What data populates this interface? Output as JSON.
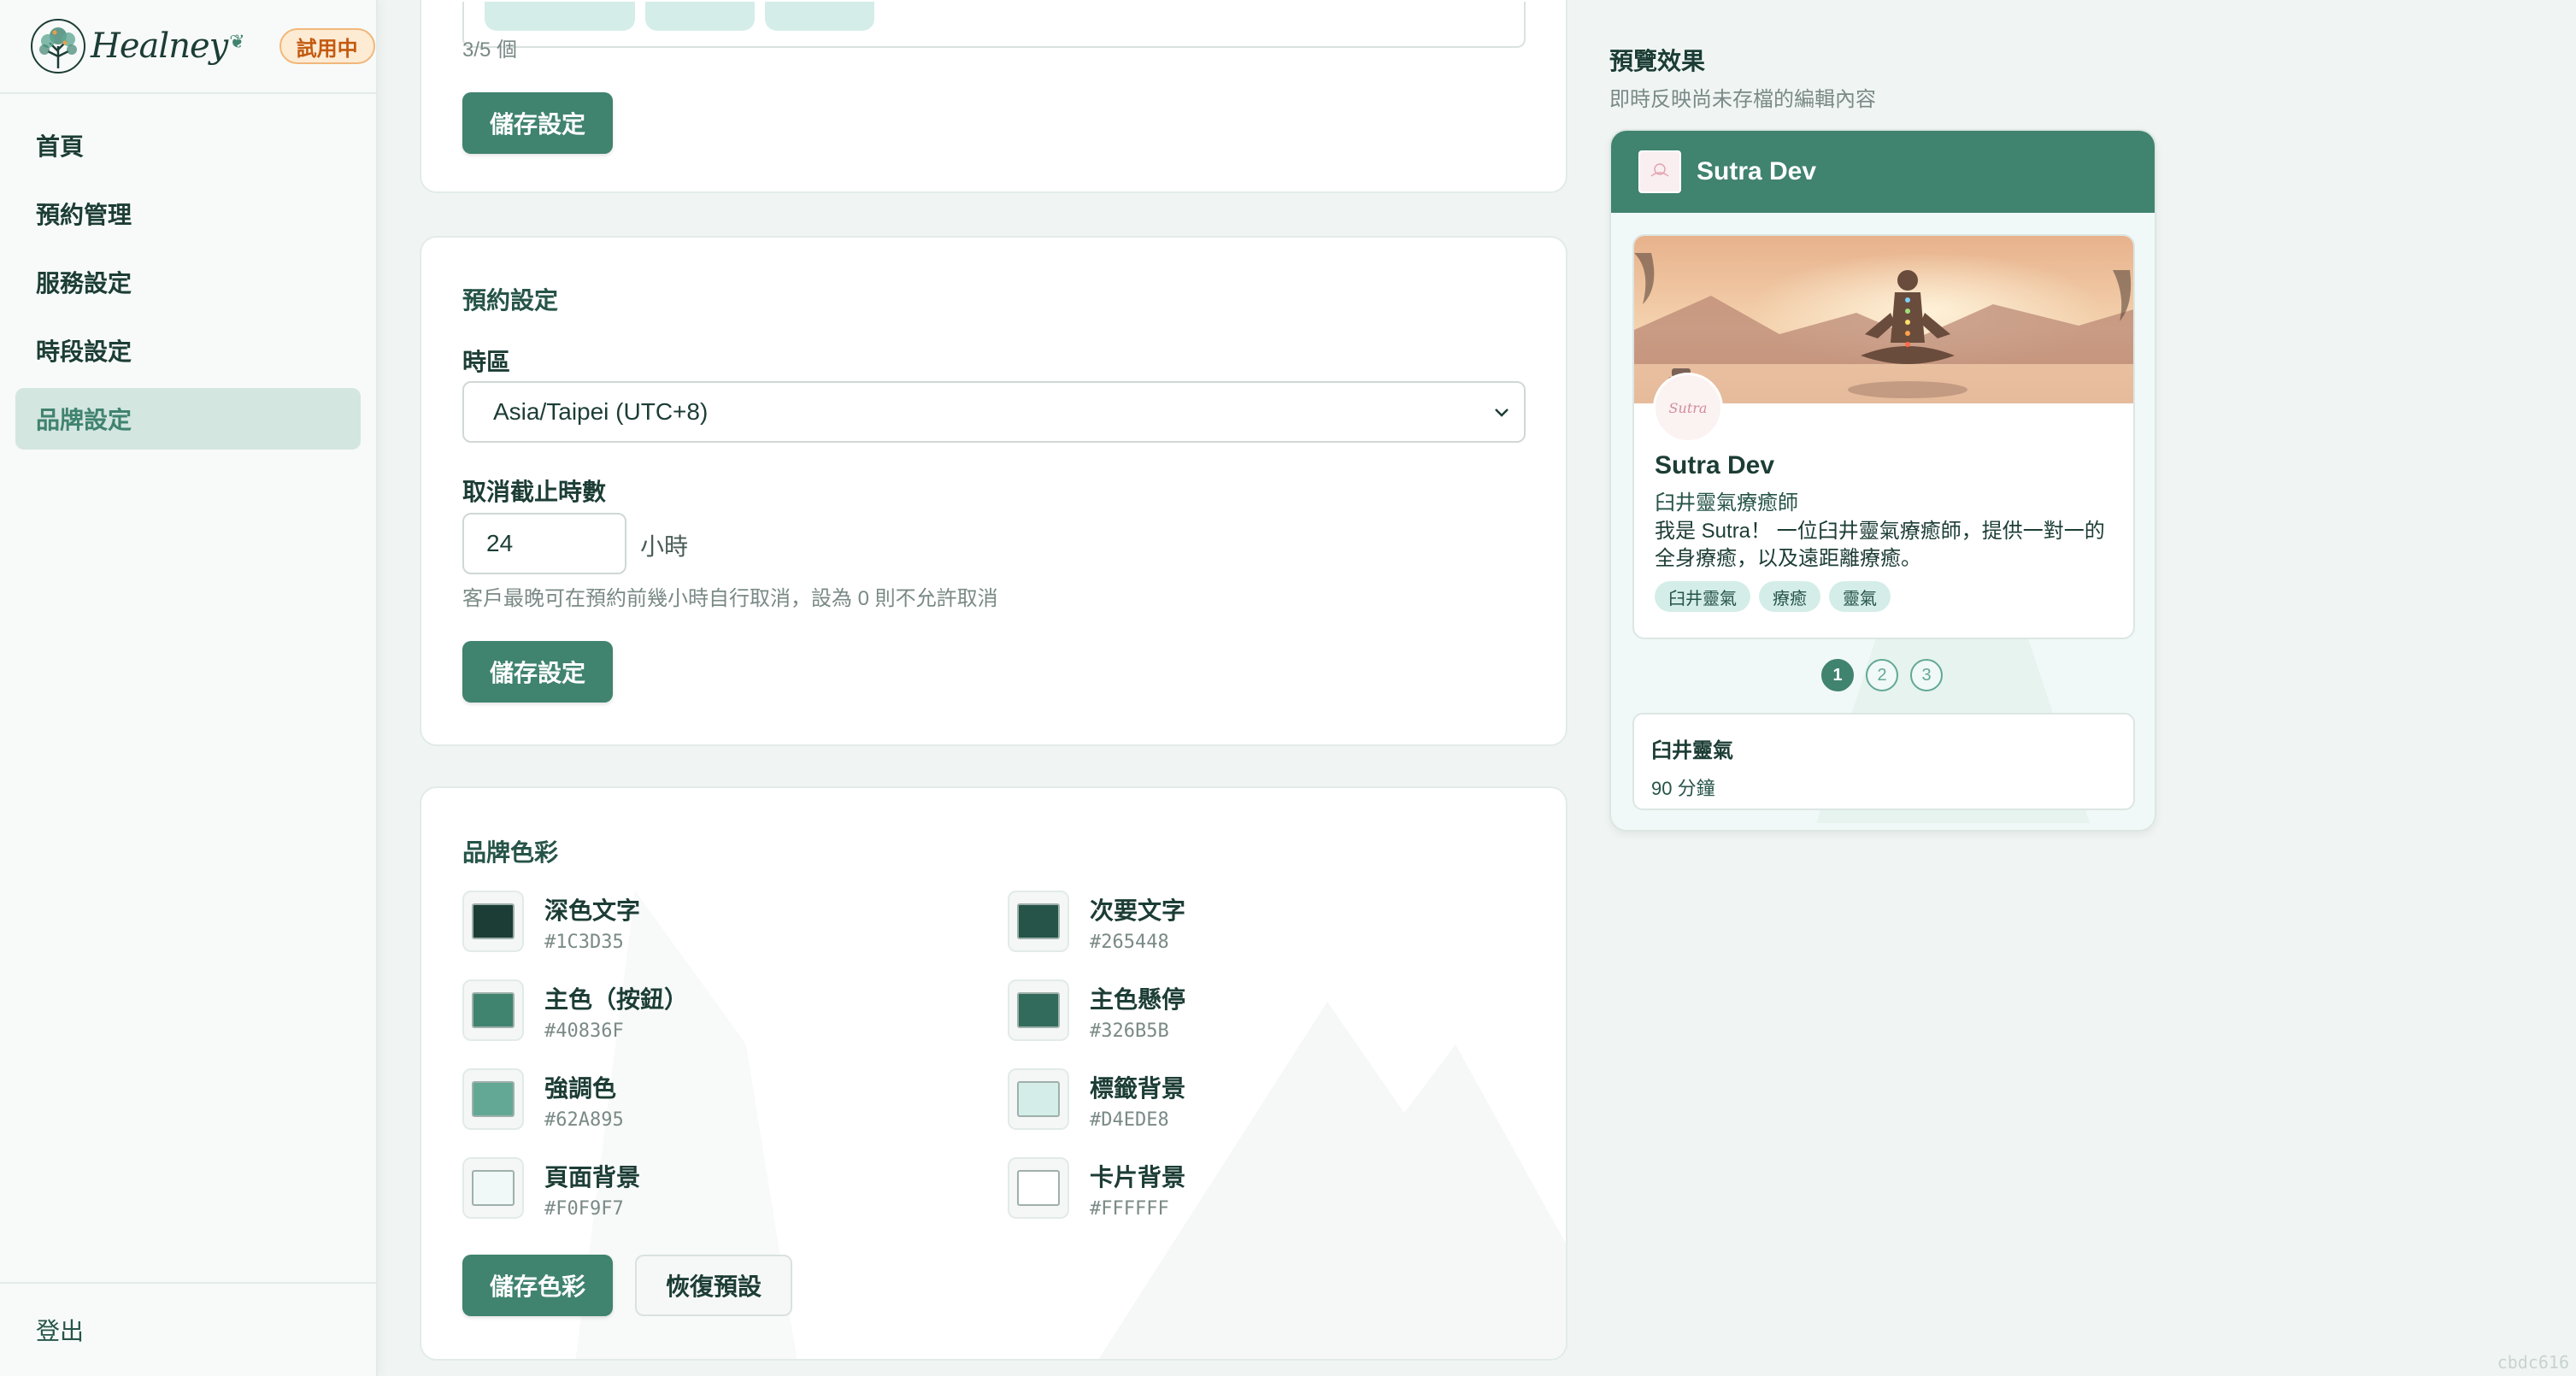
{
  "sidebar": {
    "logo_text": "Healney",
    "trial_badge": "試用中",
    "items": [
      {
        "label": "首頁"
      },
      {
        "label": "預約管理"
      },
      {
        "label": "服務設定"
      },
      {
        "label": "時段設定"
      },
      {
        "label": "品牌設定",
        "active": true
      }
    ],
    "logout": "登出"
  },
  "tags_card": {
    "count": "3/5 個",
    "save_label": "儲存設定"
  },
  "booking_card": {
    "title": "預約設定",
    "timezone_label": "時區",
    "timezone_value": "Asia/Taipei (UTC+8)",
    "cancel_label": "取消截止時數",
    "cancel_value": "24",
    "cancel_unit": "小時",
    "cancel_hint": "客戶最晚可在預約前幾小時自行取消，設為 0 則不允許取消",
    "save_label": "儲存設定"
  },
  "color_card": {
    "title": "品牌色彩",
    "colors": [
      {
        "name": "深色文字",
        "hex": "#1C3D35"
      },
      {
        "name": "次要文字",
        "hex": "#265448"
      },
      {
        "name": "主色（按鈕）",
        "hex": "#40836F"
      },
      {
        "name": "主色懸停",
        "hex": "#326B5B"
      },
      {
        "name": "強調色",
        "hex": "#62A895"
      },
      {
        "name": "標籤背景",
        "hex": "#D4EDE8"
      },
      {
        "name": "頁面背景",
        "hex": "#F0F9F7"
      },
      {
        "name": "卡片背景",
        "hex": "#FFFFFF"
      }
    ],
    "save_label": "儲存色彩",
    "reset_label": "恢復預設"
  },
  "preview": {
    "heading": "預覽效果",
    "subtitle": "即時反映尚未存檔的編輯內容",
    "header_name": "Sutra Dev",
    "profile": {
      "name": "Sutra Dev",
      "role": "臼井靈氣療癒師",
      "bio": "我是 Sutra！ 一位臼井靈氣療癒師，提供一對一的全身療癒，以及遠距離療癒。",
      "tags": [
        "臼井靈氣",
        "療癒",
        "靈氣"
      ],
      "avatar_text": "Sutra"
    },
    "pages": [
      "1",
      "2",
      "3"
    ],
    "service": {
      "name": "臼井靈氣",
      "duration": "90 分鐘"
    }
  },
  "corner_id": "cbdc616"
}
